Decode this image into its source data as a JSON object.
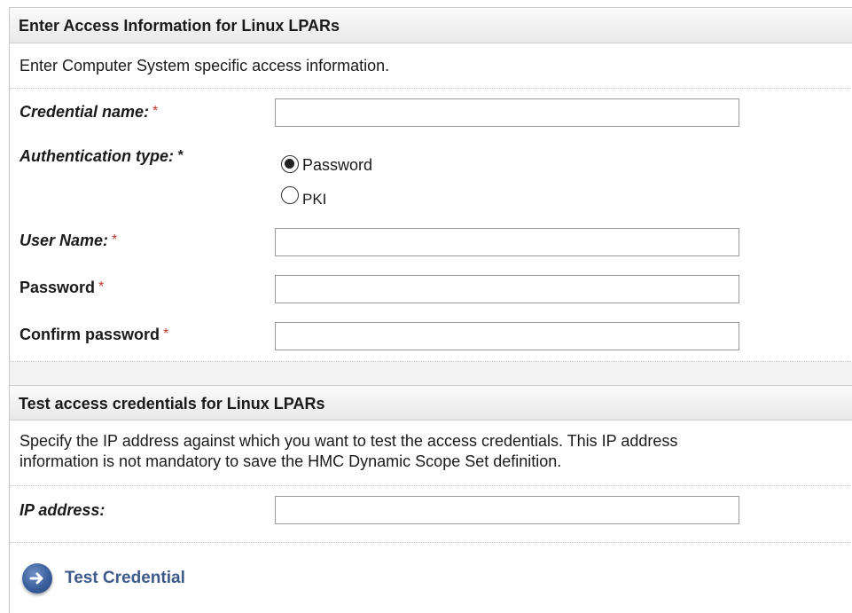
{
  "access_section": {
    "header": "Enter Access Information for Linux LPARs",
    "description": "Enter Computer System specific access information.",
    "credential_name": {
      "label": "Credential name:",
      "required_mark": "*",
      "value": ""
    },
    "authentication_type": {
      "label": "Authentication type:",
      "required_mark": "*",
      "options": [
        {
          "label": "Password",
          "selected": true
        },
        {
          "label": "PKI",
          "selected": false
        }
      ]
    },
    "user_name": {
      "label": "User Name:",
      "required_mark": "*",
      "value": ""
    },
    "password": {
      "label": "Password",
      "required_mark": "*",
      "value": ""
    },
    "confirm_password": {
      "label": "Confirm password",
      "required_mark": "*",
      "value": ""
    }
  },
  "test_section": {
    "header": "Test access credentials for Linux LPARs",
    "description_line1": "Specify the IP address against which you want to test the access credentials. This IP address",
    "description_line2": "information is not mandatory to save the HMC Dynamic Scope Set definition.",
    "ip_address": {
      "label": "IP address:",
      "value": ""
    },
    "test_button": {
      "label": "Test Credential",
      "icon": "arrow-right-icon"
    }
  },
  "colors": {
    "required": "#c0392b",
    "link": "#3d5a8a",
    "button_blue": "#3a5f9c"
  }
}
